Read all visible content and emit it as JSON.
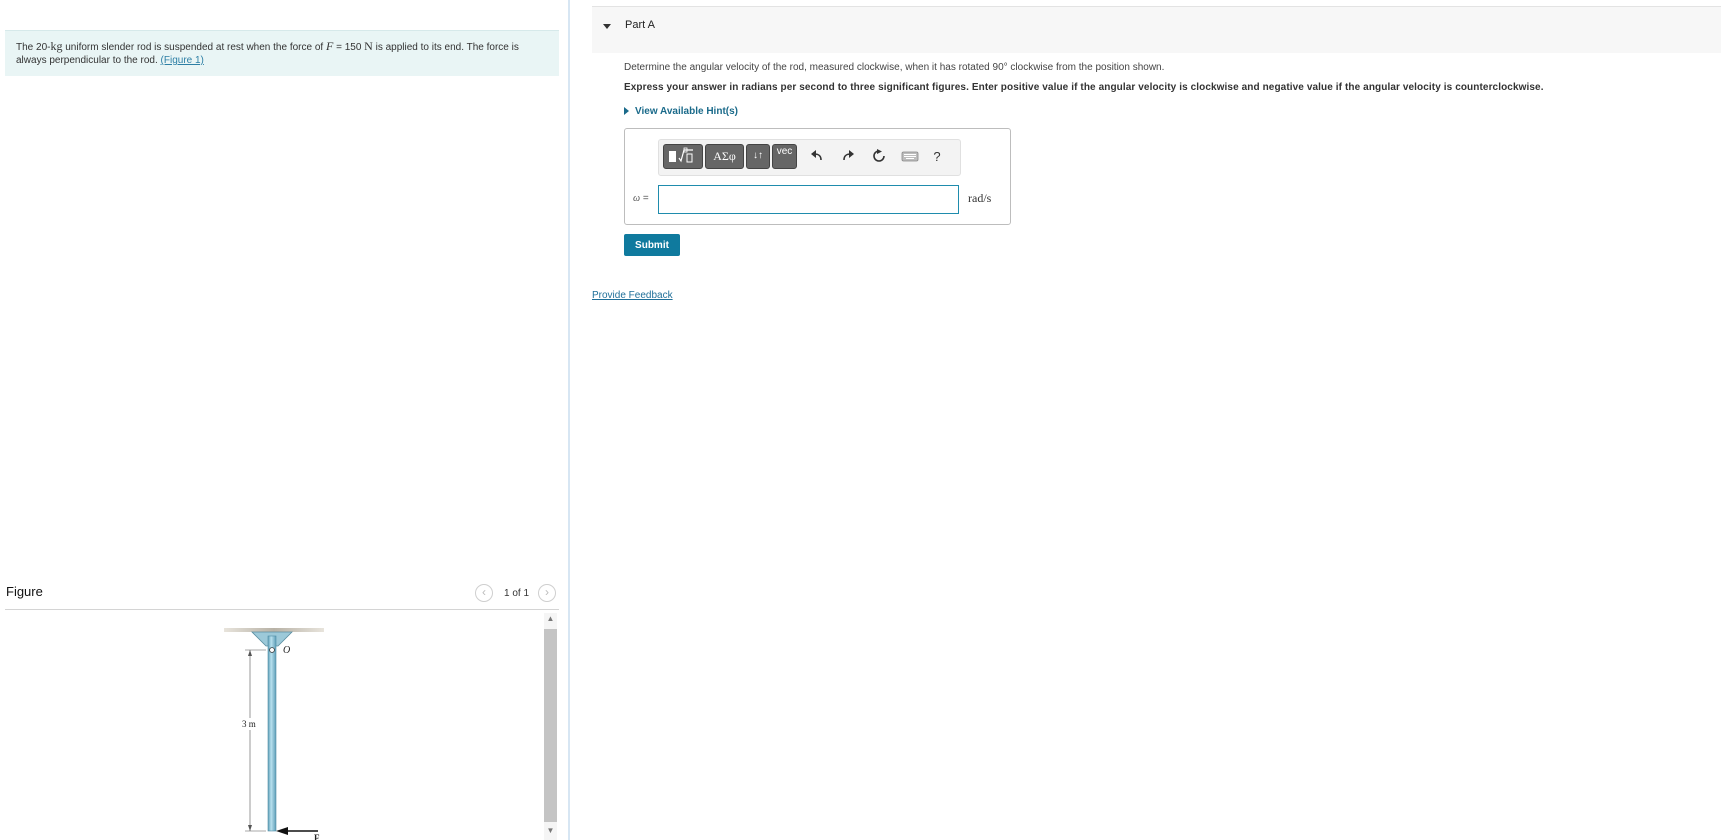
{
  "problem": {
    "text_1": "The 20-",
    "mass_unit": "kg",
    "text_2": " uniform slender rod is suspended at rest when the force of ",
    "force_symbol": "F",
    "text_3": " = 150 ",
    "force_unit": "N",
    "text_4": " is applied to its end. The force is always perpendicular to the rod. ",
    "figure_link": "(Figure 1)"
  },
  "figure": {
    "header": "Figure",
    "count": "1 of 1",
    "prev_icon": "chevron-left-icon",
    "next_icon": "chevron-right-icon",
    "prev_glyph": "‹",
    "next_glyph": "›",
    "scroll_up_glyph": "▲",
    "scroll_down_glyph": "▼",
    "labels": {
      "pivot": "O",
      "length": "3 m",
      "force": "F"
    }
  },
  "part": {
    "title": "Part A",
    "question": "Determine the angular velocity of the rod, measured clockwise, when it has rotated 90° clockwise from the position shown.",
    "instructions": "Express your answer in radians per second to three significant figures. Enter positive value if the angular velocity is clockwise and negative value if the angular velocity is counterclockwise.",
    "hint_label": "View Available Hint(s)",
    "toolbar": {
      "templates_icon": "templates-icon",
      "greek_label": "ΑΣφ",
      "arrows_label": "↓↑",
      "vec_label": "vec",
      "undo_icon": "undo-icon",
      "redo_icon": "redo-icon",
      "reset_icon": "reset-icon",
      "keyboard_icon": "keyboard-icon",
      "help_label": "?"
    },
    "answer": {
      "variable": "ω",
      "equals": " =",
      "value": "",
      "units": "rad/s"
    },
    "submit_label": "Submit"
  },
  "feedback_label": "Provide Feedback",
  "colors": {
    "accent": "#0f7a9e",
    "problem_bg": "#e9f5f5",
    "link": "#1f6f99",
    "rod": "#8fc3d6"
  }
}
